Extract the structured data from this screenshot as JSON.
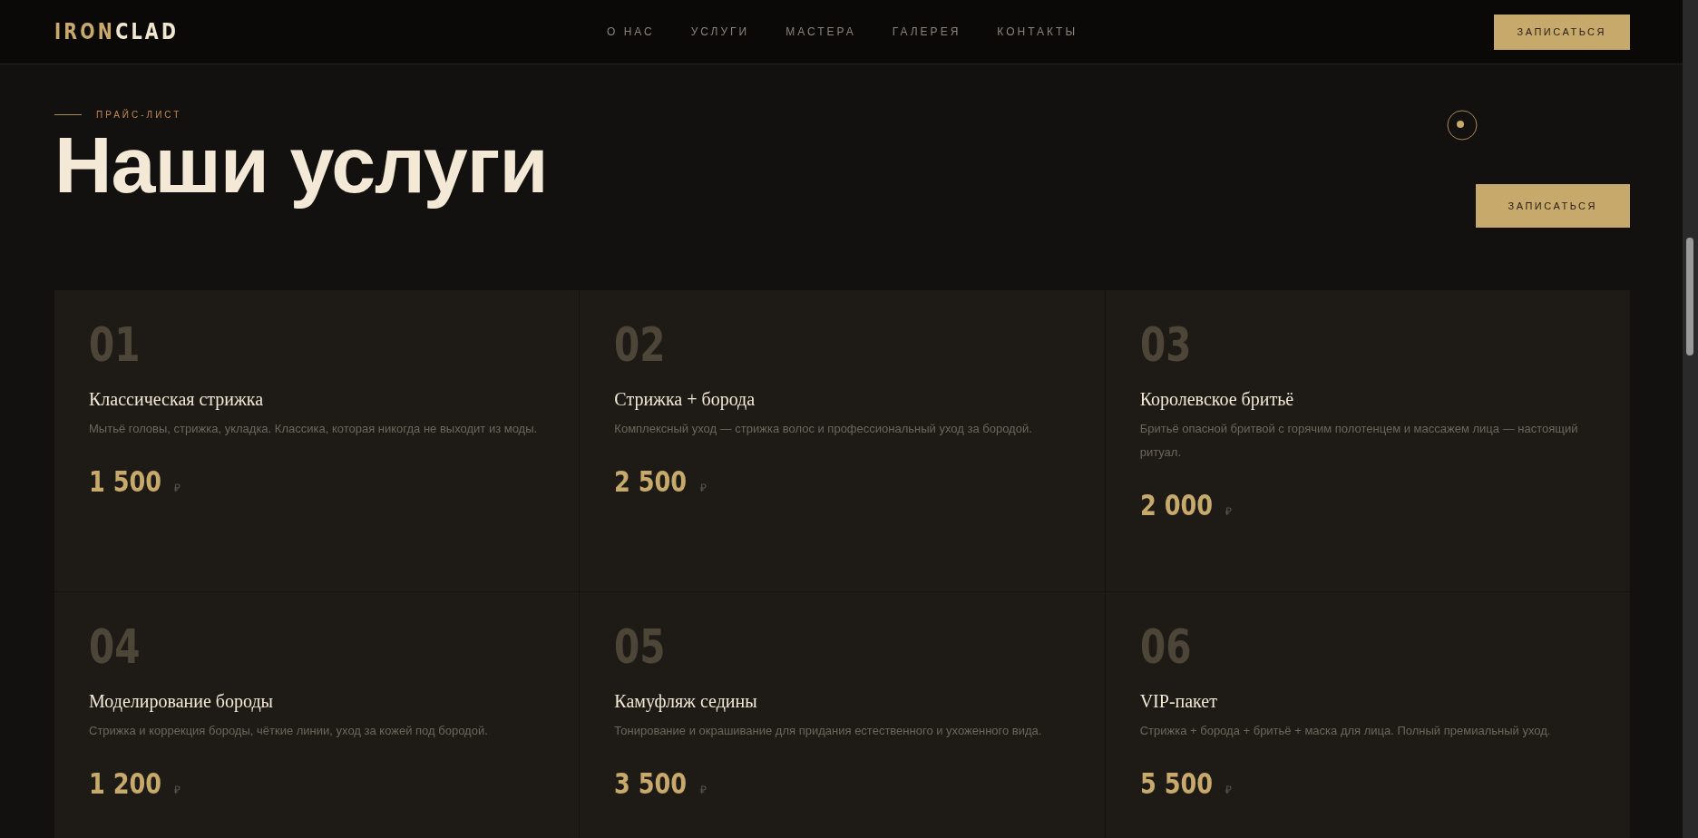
{
  "header": {
    "logo": {
      "part_1": "IRON",
      "part_2": "CLAD"
    },
    "nav": [
      "О НАС",
      "УСЛУГИ",
      "МАСТЕРА",
      "ГАЛЕРЕЯ",
      "КОНТАКТЫ"
    ],
    "cta": "ЗАПИСАТЬСЯ"
  },
  "section": {
    "eyebrow": "ПРАЙС-ЛИСТ",
    "title": "Наши услуги",
    "cta": "ЗАПИСАТЬСЯ"
  },
  "services": [
    {
      "number": "01",
      "title": "Классическая стрижка",
      "description": "Мытьё головы, стрижка, укладка. Классика, которая никогда не выходит из моды.",
      "price": "1 500",
      "currency": "₽"
    },
    {
      "number": "02",
      "title": "Стрижка + борода",
      "description": "Комплексный уход — стрижка волос и профессиональный уход за бородой.",
      "price": "2 500",
      "currency": "₽"
    },
    {
      "number": "03",
      "title": "Королевское бритьё",
      "description": "Бритьё опасной бритвой с горячим полотенцем и массажем лица — настоящий ритуал.",
      "price": "2 000",
      "currency": "₽"
    },
    {
      "number": "04",
      "title": "Моделирование бороды",
      "description": "Стрижка и коррекция бороды, чёткие линии, уход за кожей под бородой.",
      "price": "1 200",
      "currency": "₽"
    },
    {
      "number": "05",
      "title": "Камуфляж седины",
      "description": "Тонирование и окрашивание для придания естественного и ухоженного вида.",
      "price": "3 500",
      "currency": "₽"
    },
    {
      "number": "06",
      "title": "VIP-пакет",
      "description": "Стрижка + борода + бритьё + маска для лица. Полный премиальный уход.",
      "price": "5 500",
      "currency": "₽"
    }
  ]
}
